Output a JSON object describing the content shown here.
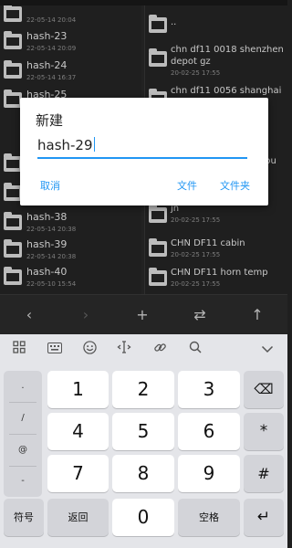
{
  "left_pane": [
    {
      "name": "",
      "date": "22-05-14 20:04"
    },
    {
      "name": "hash-23",
      "date": "22-05-14 20:09"
    },
    {
      "name": "hash-24",
      "date": "22-05-14 16:37"
    },
    {
      "name": "hash-25",
      "date": ""
    },
    {
      "name": "",
      "date": ""
    },
    {
      "name": "",
      "date": ""
    },
    {
      "name": "hash-38",
      "date": "22-05-14 20:38"
    },
    {
      "name": "hash-39",
      "date": "22-05-14 20:38"
    },
    {
      "name": "hash-40",
      "date": "22-05-10 15:54"
    }
  ],
  "right_pane": [
    {
      "name1": "..",
      "name2": "",
      "date": ""
    },
    {
      "name1": "chn df11 0018 shenzhen",
      "name2": "depot gz",
      "date": "20-02-25 17:55"
    },
    {
      "name1": "chn df11 0056 shanghai",
      "name2": "",
      "date": ""
    },
    {
      "name1": "",
      "name2": "",
      "date": ""
    },
    {
      "name1": "",
      "name2": "hou",
      "date": ""
    },
    {
      "name1": "",
      "name2": "jn",
      "date": "20-02-25 17:55"
    },
    {
      "name1": "CHN DF11 cabin",
      "name2": "",
      "date": "20-02-25 17:55"
    },
    {
      "name1": "CHN DF11 horn temp",
      "name2": "",
      "date": "20-02-25 17:55"
    }
  ],
  "toolbar": {
    "back": "‹",
    "forward": "›",
    "add": "+",
    "swap": "⇄",
    "up": "↑"
  },
  "dialog": {
    "title": "新建",
    "input_value": "hash-29",
    "cancel": "取消",
    "file": "文件",
    "folder": "文件夹"
  },
  "keyboard": {
    "top_icons": [
      "grid-icon",
      "keyboard-icon",
      "emoji-icon",
      "cursor-icon",
      "link-icon",
      "search-icon",
      "chevron-down-icon"
    ],
    "side_keys": [
      ".",
      "/",
      "@",
      "-"
    ],
    "digits": [
      "1",
      "2",
      "3",
      "4",
      "5",
      "6",
      "7",
      "8",
      "9",
      "0"
    ],
    "symbol": "符号",
    "back": "返回",
    "space": "空格",
    "star": "*",
    "hash": "#",
    "backspace_glyph": "⌫",
    "enter_glyph": "↵"
  }
}
